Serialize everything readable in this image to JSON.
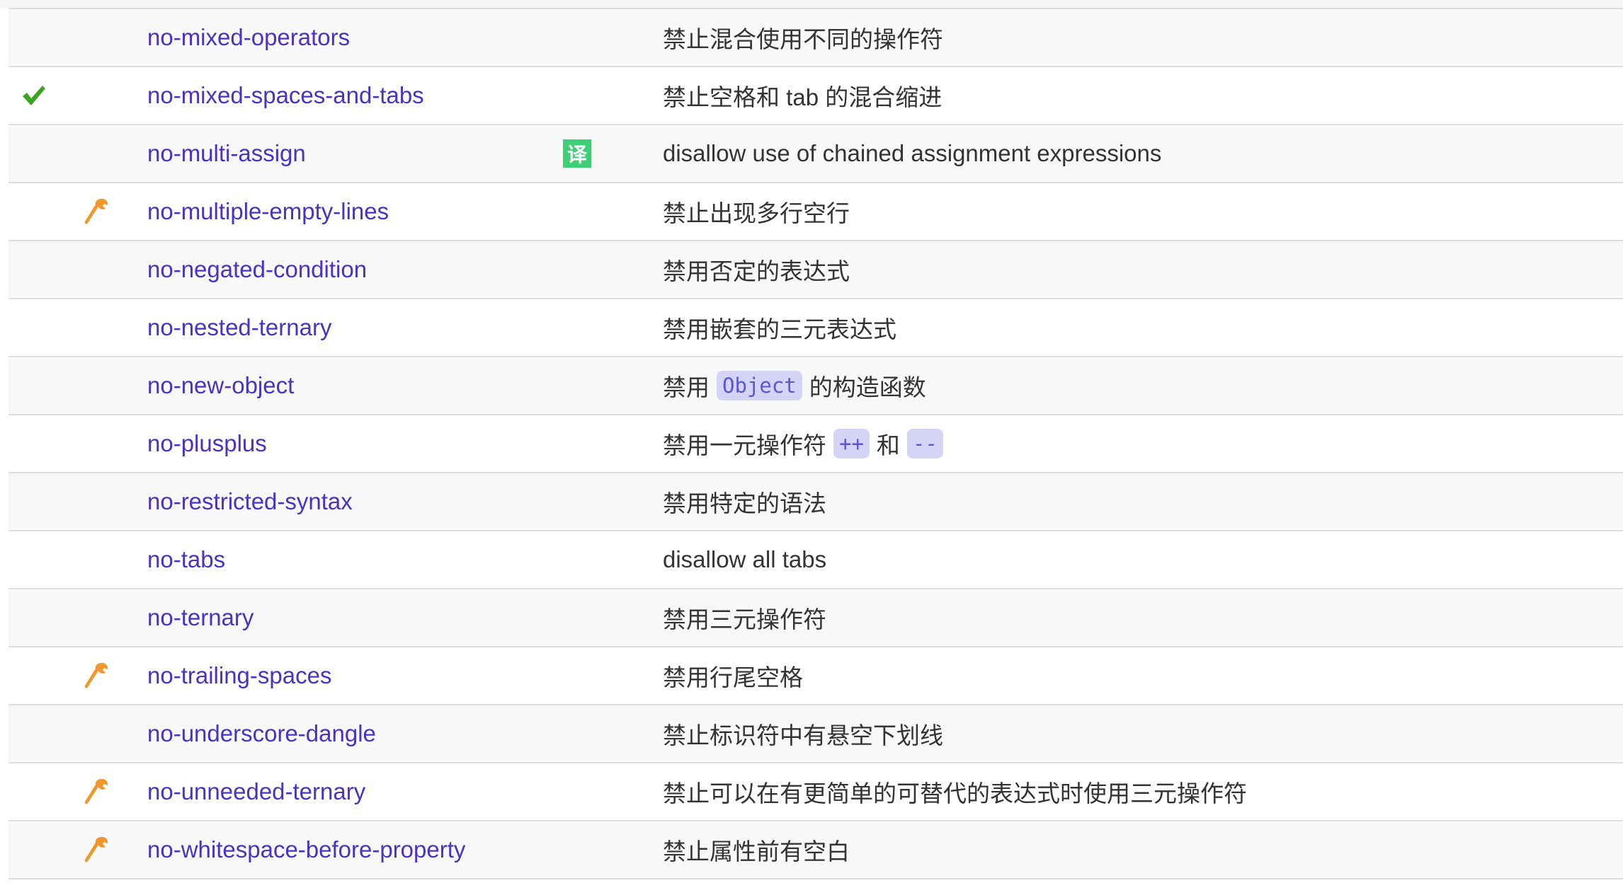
{
  "colors": {
    "link": "#4b32c3",
    "check": "#3aa51f",
    "wrench": "#f0962a",
    "badge": "#3ecf77"
  },
  "rules": [
    {
      "name": "no-mixed-operators",
      "desc": [
        "禁止混合使用不同的操作符"
      ]
    },
    {
      "name": "no-mixed-spaces-and-tabs",
      "recommended": true,
      "desc": [
        "禁止空格和 tab 的混合缩进"
      ]
    },
    {
      "name": "no-multi-assign",
      "badge": "译",
      "desc": [
        "disallow use of chained assignment expressions"
      ]
    },
    {
      "name": "no-multiple-empty-lines",
      "fixable": true,
      "desc": [
        "禁止出现多行空行"
      ]
    },
    {
      "name": "no-negated-condition",
      "desc": [
        "禁用否定的表达式"
      ]
    },
    {
      "name": "no-nested-ternary",
      "desc": [
        "禁用嵌套的三元表达式"
      ]
    },
    {
      "name": "no-new-object",
      "desc": [
        "禁用",
        {
          "code": "Object"
        },
        "的构造函数"
      ]
    },
    {
      "name": "no-plusplus",
      "desc": [
        "禁用一元操作符",
        {
          "code": "++"
        },
        "和",
        {
          "code": "--"
        }
      ]
    },
    {
      "name": "no-restricted-syntax",
      "desc": [
        "禁用特定的语法"
      ]
    },
    {
      "name": "no-tabs",
      "desc": [
        "disallow all tabs"
      ]
    },
    {
      "name": "no-ternary",
      "desc": [
        "禁用三元操作符"
      ]
    },
    {
      "name": "no-trailing-spaces",
      "fixable": true,
      "desc": [
        "禁用行尾空格"
      ]
    },
    {
      "name": "no-underscore-dangle",
      "desc": [
        "禁止标识符中有悬空下划线"
      ]
    },
    {
      "name": "no-unneeded-ternary",
      "fixable": true,
      "desc": [
        "禁止可以在有更简单的可替代的表达式时使用三元操作符"
      ]
    },
    {
      "name": "no-whitespace-before-property",
      "fixable": true,
      "desc": [
        "禁止属性前有空白"
      ]
    }
  ]
}
